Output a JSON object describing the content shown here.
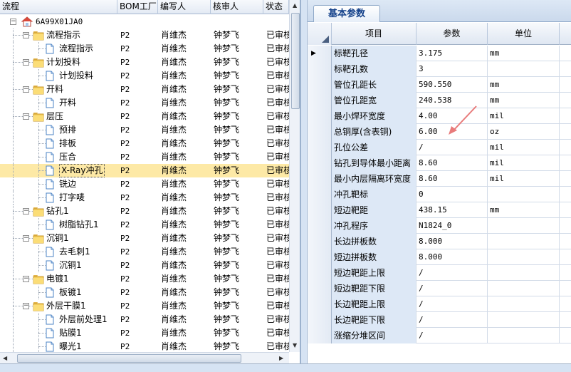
{
  "tree_panel": {
    "columns": [
      "流程",
      "BOM工厂",
      "编写人",
      "核审人",
      "状态"
    ],
    "root": {
      "label": "6A99X01JA0"
    },
    "rows": [
      {
        "level": 1,
        "kind": "folder",
        "expanded": true,
        "label": "流程指示",
        "bom": "P2",
        "author": "肖维杰",
        "reviewer": "钟梦飞",
        "status": "已审核"
      },
      {
        "level": 2,
        "kind": "doc",
        "label": "流程指示",
        "bom": "P2",
        "author": "肖维杰",
        "reviewer": "钟梦飞",
        "status": "已审核"
      },
      {
        "level": 1,
        "kind": "folder",
        "expanded": true,
        "label": "计划投料",
        "bom": "P2",
        "author": "肖维杰",
        "reviewer": "钟梦飞",
        "status": "已审核"
      },
      {
        "level": 2,
        "kind": "doc",
        "label": "计划投料",
        "bom": "P2",
        "author": "肖维杰",
        "reviewer": "钟梦飞",
        "status": "已审核"
      },
      {
        "level": 1,
        "kind": "folder",
        "expanded": true,
        "label": "开料",
        "bom": "P2",
        "author": "肖维杰",
        "reviewer": "钟梦飞",
        "status": "已审核"
      },
      {
        "level": 2,
        "kind": "doc",
        "label": "开料",
        "bom": "P2",
        "author": "肖维杰",
        "reviewer": "钟梦飞",
        "status": "已审核"
      },
      {
        "level": 1,
        "kind": "folder",
        "expanded": true,
        "label": "层压",
        "bom": "P2",
        "author": "肖维杰",
        "reviewer": "钟梦飞",
        "status": "已审核"
      },
      {
        "level": 2,
        "kind": "doc",
        "label": "预排",
        "bom": "P2",
        "author": "肖维杰",
        "reviewer": "钟梦飞",
        "status": "已审核"
      },
      {
        "level": 2,
        "kind": "doc",
        "label": "排板",
        "bom": "P2",
        "author": "肖维杰",
        "reviewer": "钟梦飞",
        "status": "已审核"
      },
      {
        "level": 2,
        "kind": "doc",
        "label": "压合",
        "bom": "P2",
        "author": "肖维杰",
        "reviewer": "钟梦飞",
        "status": "已审核"
      },
      {
        "level": 2,
        "kind": "doc",
        "label": "X-Ray冲孔",
        "bom": "P2",
        "author": "肖维杰",
        "reviewer": "钟梦飞",
        "status": "已审核",
        "selected": true
      },
      {
        "level": 2,
        "kind": "doc",
        "label": "铣边",
        "bom": "P2",
        "author": "肖维杰",
        "reviewer": "钟梦飞",
        "status": "已审核"
      },
      {
        "level": 2,
        "kind": "doc",
        "label": "打字唛",
        "bom": "P2",
        "author": "肖维杰",
        "reviewer": "钟梦飞",
        "status": "已审核"
      },
      {
        "level": 1,
        "kind": "folder",
        "expanded": true,
        "label": "钻孔1",
        "bom": "P2",
        "author": "肖维杰",
        "reviewer": "钟梦飞",
        "status": "已审核"
      },
      {
        "level": 2,
        "kind": "doc",
        "label": "树脂钻孔1",
        "bom": "P2",
        "author": "肖维杰",
        "reviewer": "钟梦飞",
        "status": "已审核"
      },
      {
        "level": 1,
        "kind": "folder",
        "expanded": true,
        "label": "沉铜1",
        "bom": "P2",
        "author": "肖维杰",
        "reviewer": "钟梦飞",
        "status": "已审核"
      },
      {
        "level": 2,
        "kind": "doc",
        "label": "去毛刺1",
        "bom": "P2",
        "author": "肖维杰",
        "reviewer": "钟梦飞",
        "status": "已审核"
      },
      {
        "level": 2,
        "kind": "doc",
        "label": "沉铜1",
        "bom": "P2",
        "author": "肖维杰",
        "reviewer": "钟梦飞",
        "status": "已审核"
      },
      {
        "level": 1,
        "kind": "folder",
        "expanded": true,
        "label": "电镀1",
        "bom": "P2",
        "author": "肖维杰",
        "reviewer": "钟梦飞",
        "status": "已审核"
      },
      {
        "level": 2,
        "kind": "doc",
        "label": "板镀1",
        "bom": "P2",
        "author": "肖维杰",
        "reviewer": "钟梦飞",
        "status": "已审核"
      },
      {
        "level": 1,
        "kind": "folder",
        "expanded": true,
        "label": "外层干膜1",
        "bom": "P2",
        "author": "肖维杰",
        "reviewer": "钟梦飞",
        "status": "已审核"
      },
      {
        "level": 2,
        "kind": "doc",
        "label": "外层前处理1",
        "bom": "P2",
        "author": "肖维杰",
        "reviewer": "钟梦飞",
        "status": "已审核"
      },
      {
        "level": 2,
        "kind": "doc",
        "label": "贴膜1",
        "bom": "P2",
        "author": "肖维杰",
        "reviewer": "钟梦飞",
        "status": "已审核"
      },
      {
        "level": 2,
        "kind": "doc",
        "label": "曝光1",
        "bom": "P2",
        "author": "肖维杰",
        "reviewer": "钟梦飞",
        "status": "已审核"
      }
    ]
  },
  "param_panel": {
    "tab_label": "基本参数",
    "columns": [
      "项目",
      "参数",
      "单位"
    ],
    "rows": [
      {
        "name": "标靶孔径",
        "value": "3.175",
        "unit": "mm",
        "current": true
      },
      {
        "name": "标靶孔数",
        "value": "3",
        "unit": ""
      },
      {
        "name": "管位孔距长",
        "value": "590.550",
        "unit": "mm"
      },
      {
        "name": "管位孔距宽",
        "value": "240.538",
        "unit": "mm"
      },
      {
        "name": "最小焊环宽度",
        "value": "4.00",
        "unit": "mil"
      },
      {
        "name": "总铜厚(含表铜)",
        "value": "6.00",
        "unit": "oz"
      },
      {
        "name": "孔位公差",
        "value": "/",
        "unit": "mil"
      },
      {
        "name": "钻孔到导体最小距离",
        "value": "8.60",
        "unit": "mil"
      },
      {
        "name": "最小内层隔离环宽度",
        "value": "8.60",
        "unit": "mil"
      },
      {
        "name": "冲孔靶标",
        "value": "0",
        "unit": ""
      },
      {
        "name": "短边靶距",
        "value": "438.15",
        "unit": "mm"
      },
      {
        "name": "冲孔程序",
        "value": "N1824_0",
        "unit": ""
      },
      {
        "name": "长边拼板数",
        "value": "8.000",
        "unit": ""
      },
      {
        "name": "短边拼板数",
        "value": "8.000",
        "unit": ""
      },
      {
        "name": "短边靶距上限",
        "value": "/",
        "unit": ""
      },
      {
        "name": "短边靶距下限",
        "value": "/",
        "unit": ""
      },
      {
        "name": "长边靶距上限",
        "value": "/",
        "unit": ""
      },
      {
        "name": "长边靶距下限",
        "value": "/",
        "unit": ""
      },
      {
        "name": "涨缩分堆区间",
        "value": "/",
        "unit": ""
      }
    ]
  },
  "colors": {
    "selected_row": "#fde9a6",
    "name_cell_bg": "#dde8f6",
    "annotation_arrow": "#e87b7b",
    "tab_text": "#15428b"
  }
}
